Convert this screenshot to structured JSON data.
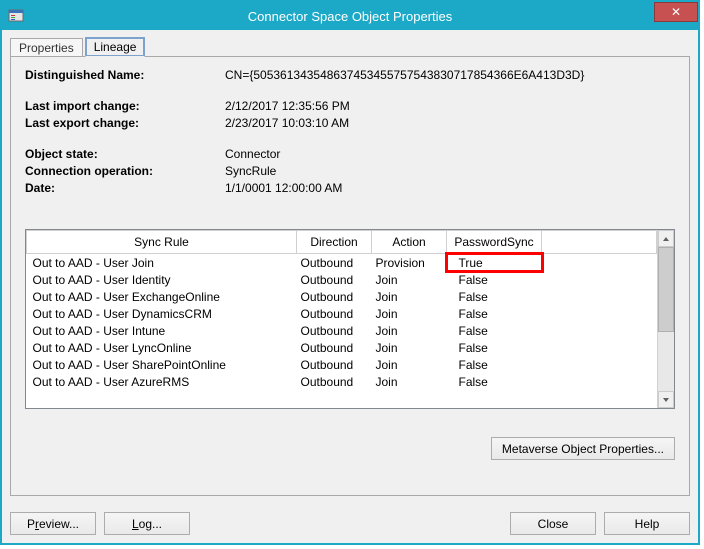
{
  "window": {
    "title": "Connector Space Object Properties",
    "close_glyph": "✕"
  },
  "tabs": {
    "properties": "Properties",
    "lineage": "Lineage"
  },
  "fields": {
    "dn_label": "Distinguished Name:",
    "dn_value": "CN={505361343548637453455757543830717854366E6A413D3D}",
    "last_import_label": "Last import change:",
    "last_import_value": "2/12/2017 12:35:56 PM",
    "last_export_label": "Last export change:",
    "last_export_value": "2/23/2017 10:03:10 AM",
    "object_state_label": "Object state:",
    "object_state_value": "Connector",
    "conn_op_label": "Connection operation:",
    "conn_op_value": "SyncRule",
    "date_label": "Date:",
    "date_value": "1/1/0001 12:00:00 AM"
  },
  "grid": {
    "headers": {
      "rule": "Sync Rule",
      "direction": "Direction",
      "action": "Action",
      "pw": "PasswordSync"
    },
    "rows": [
      {
        "rule": "Out to AAD - User Join",
        "direction": "Outbound",
        "action": "Provision",
        "pw": "True",
        "highlight": true
      },
      {
        "rule": "Out to AAD - User Identity",
        "direction": "Outbound",
        "action": "Join",
        "pw": "False",
        "highlight": false
      },
      {
        "rule": "Out to AAD - User ExchangeOnline",
        "direction": "Outbound",
        "action": "Join",
        "pw": "False",
        "highlight": false
      },
      {
        "rule": "Out to AAD - User DynamicsCRM",
        "direction": "Outbound",
        "action": "Join",
        "pw": "False",
        "highlight": false
      },
      {
        "rule": "Out to AAD - User Intune",
        "direction": "Outbound",
        "action": "Join",
        "pw": "False",
        "highlight": false
      },
      {
        "rule": "Out to AAD - User LyncOnline",
        "direction": "Outbound",
        "action": "Join",
        "pw": "False",
        "highlight": false
      },
      {
        "rule": "Out to AAD - User SharePointOnline",
        "direction": "Outbound",
        "action": "Join",
        "pw": "False",
        "highlight": false
      },
      {
        "rule": "Out to AAD - User AzureRMS",
        "direction": "Outbound",
        "action": "Join",
        "pw": "False",
        "highlight": false
      }
    ]
  },
  "buttons": {
    "metaverse": "Metaverse Object Properties...",
    "preview_pre": "P",
    "preview_und": "r",
    "preview_post": "eview...",
    "log_und": "L",
    "log_post": "og...",
    "close": "Close",
    "help": "Help"
  }
}
